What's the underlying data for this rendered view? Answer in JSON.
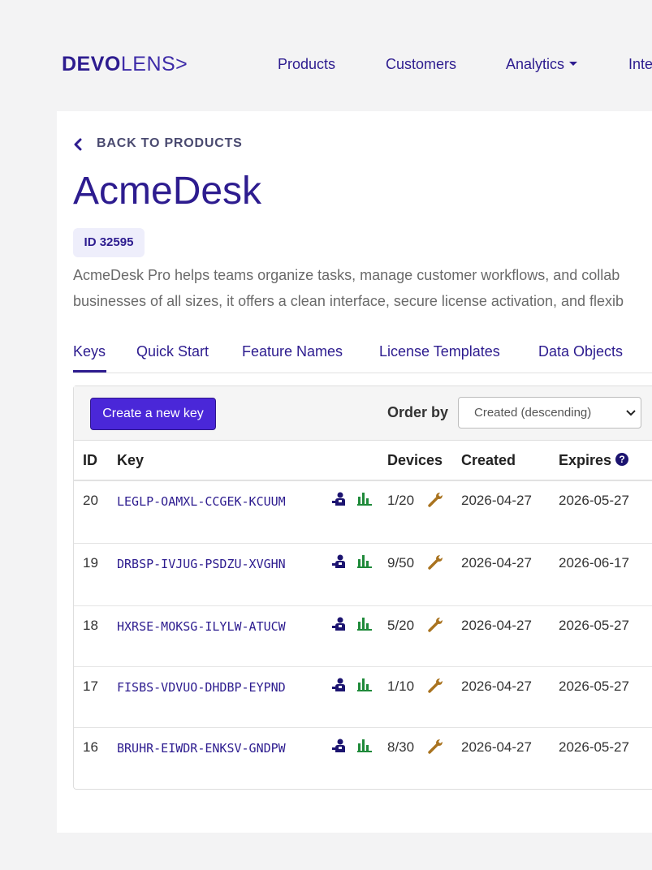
{
  "brand": {
    "bold": "DEVO",
    "light": "LENS>"
  },
  "nav": {
    "products": "Products",
    "customers": "Customers",
    "analytics": "Analytics",
    "integrations": "Inte"
  },
  "back_link": "BACK TO PRODUCTS",
  "product": {
    "title": "AcmeDesk",
    "id_badge": "ID 32595",
    "description_line1": "AcmeDesk Pro helps teams organize tasks, manage customer workflows, and collab",
    "description_line2": "businesses of all sizes, it offers a clean interface, secure license activation, and flexib"
  },
  "tabs": [
    "Keys",
    "Quick Start",
    "Feature Names",
    "License Templates",
    "Data Objects"
  ],
  "toolbar": {
    "create_label": "Create a new key",
    "order_label": "Order by",
    "order_value": "Created (descending)"
  },
  "table": {
    "headers": {
      "id": "ID",
      "key": "Key",
      "devices": "Devices",
      "created": "Created",
      "expires": "Expires"
    },
    "rows": [
      {
        "id": "20",
        "key": "LEGLP-OAMXL-CCGEK-KCUUM",
        "devices": "1/20",
        "created": "2026-04-27",
        "expires": "2026-05-27"
      },
      {
        "id": "19",
        "key": "DRBSP-IVJUG-PSDZU-XVGHN",
        "devices": "9/50",
        "created": "2026-04-27",
        "expires": "2026-06-17"
      },
      {
        "id": "18",
        "key": "HXRSE-MOKSG-ILYLW-ATUCW",
        "devices": "5/20",
        "created": "2026-04-27",
        "expires": "2026-05-27"
      },
      {
        "id": "17",
        "key": "FISBS-VDVUO-DHDBP-EYPND",
        "devices": "1/10",
        "created": "2026-04-27",
        "expires": "2026-05-27"
      },
      {
        "id": "16",
        "key": "BRUHR-EIWDR-ENKSV-GNDPW",
        "devices": "8/30",
        "created": "2026-04-27",
        "expires": "2026-05-27"
      }
    ]
  },
  "icons": {
    "back": "chevron-left-icon",
    "customer": "user-icon",
    "analytics": "bar-chart-icon",
    "devices": "wrench-icon",
    "help": "question-circle-icon",
    "select": "chevron-down-icon"
  },
  "colors": {
    "primary": "#2d1c8f",
    "button": "#4a27d8",
    "chart": "#1f8a3a",
    "wrench": "#a9731f"
  }
}
